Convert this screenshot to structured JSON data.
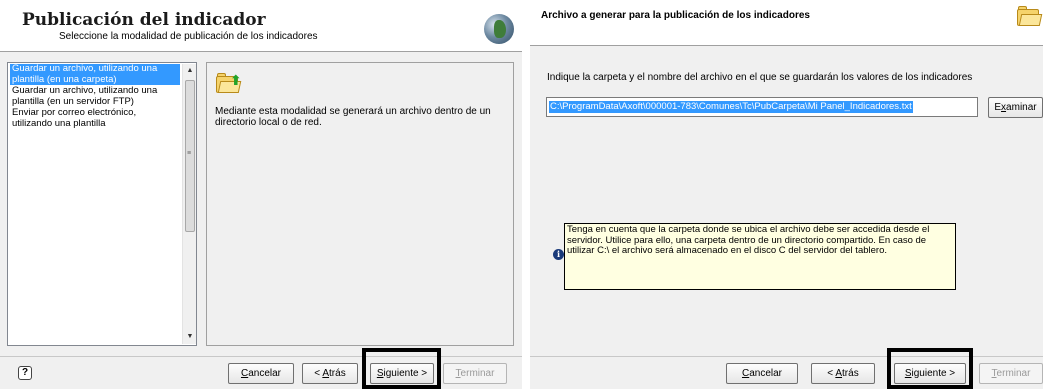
{
  "left": {
    "title": "Publicación del indicador",
    "subtitle": "Seleccione la modalidad de publicación de los indicadores",
    "list_items": [
      "Guardar un archivo, utilizando una plantilla (en una carpeta)",
      "Guardar un archivo, utilizando una plantilla (en un servidor FTP)",
      "Enviar por correo electrónico, utilizando una plantilla"
    ],
    "description": "Mediante esta modalidad se generará un archivo dentro de un directorio local o de red.",
    "help_icon": "?",
    "buttons": {
      "cancel_pre": "",
      "cancel_acc": "C",
      "cancel_post": "ancelar",
      "back_pre": "< ",
      "back_acc": "A",
      "back_post": "trás",
      "next_pre": "",
      "next_acc": "S",
      "next_post": "iguiente >",
      "finish_pre": "",
      "finish_acc": "T",
      "finish_post": "erminar"
    }
  },
  "right": {
    "title": "Archivo a generar para la publicación de los indicadores",
    "prompt": "Indique la carpeta y el nombre del archivo en el que se guardarán los valores de los indicadores",
    "path_value": "C:\\ProgramData\\Axoft\\000001-783\\Comunes\\Tc\\PubCarpeta\\Mi Panel_Indicadores.txt",
    "browse_pre": "E",
    "browse_acc": "x",
    "browse_post": "aminar",
    "info_icon": "i",
    "note": "Tenga en cuenta que la carpeta donde se ubica el archivo debe ser accedida desde el servidor. Utilice para ello, una carpeta dentro de un directorio compartido. En caso de utilizar C:\\ el archivo será almacenado en el disco C  del servidor del tablero.",
    "buttons": {
      "cancel_acc": "C",
      "cancel_post": "ancelar",
      "back_pre": "< ",
      "back_acc": "A",
      "back_post": "trás",
      "next_acc": "S",
      "next_post": "iguiente >",
      "finish_acc": "T",
      "finish_post": "erminar"
    }
  },
  "colors": {
    "selection": "#3399ff",
    "note_background": "#ffffe1",
    "highlight_border": "#000000"
  }
}
